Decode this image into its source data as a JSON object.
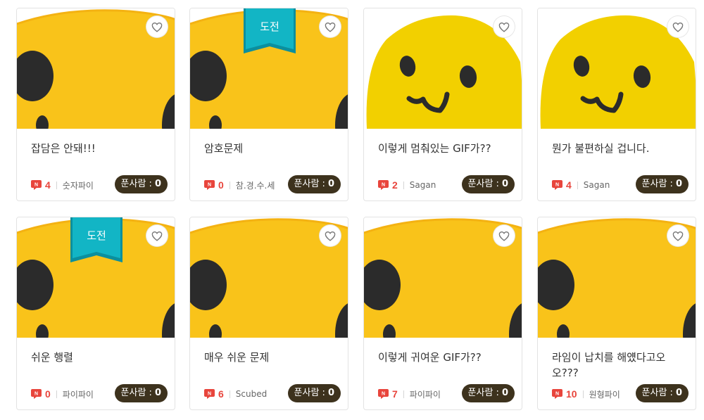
{
  "cards": [
    {
      "title": "잡담은 안돼!!!",
      "solved_label": "푼사람 :",
      "solved_count": "0",
      "comments": "4",
      "author": "숫자파이",
      "challenge": false,
      "image": "face-zoom"
    },
    {
      "title": "암호문제",
      "solved_label": "푼사람 :",
      "solved_count": "0",
      "comments": "0",
      "author": "참.경.수.세",
      "challenge": true,
      "image": "face-zoom"
    },
    {
      "title": "이렇게 멈춰있는 GIF가??",
      "solved_label": "푼사람 :",
      "solved_count": "0",
      "comments": "2",
      "author": "Sagan",
      "challenge": false,
      "image": "face-small"
    },
    {
      "title": "뭔가 불편하실 겁니다.",
      "solved_label": "푼사람 :",
      "solved_count": "0",
      "comments": "4",
      "author": "Sagan",
      "challenge": false,
      "image": "face-small"
    },
    {
      "title": "쉬운 행렬",
      "solved_label": "푼사람 :",
      "solved_count": "0",
      "comments": "0",
      "author": "파이파이",
      "challenge": true,
      "image": "face-zoom"
    },
    {
      "title": "매우 쉬운 문제",
      "solved_label": "푼사람 :",
      "solved_count": "0",
      "comments": "6",
      "author": "Scubed",
      "challenge": false,
      "image": "face-zoom"
    },
    {
      "title": "이렇게 귀여운 GIF가??",
      "solved_label": "푼사람 :",
      "solved_count": "0",
      "comments": "7",
      "author": "파이파이",
      "challenge": false,
      "image": "face-zoom"
    },
    {
      "title": "라임이 납치를 해얬다고오오???",
      "solved_label": "푼사람 :",
      "solved_count": "0",
      "comments": "10",
      "author": "원형파이",
      "challenge": false,
      "image": "face-zoom"
    }
  ],
  "challenge_label": "도전",
  "colors": {
    "face_yellow": "#F9C31A",
    "face_small_yellow": "#F2D000",
    "eye": "#2B2B2B",
    "ribbon": "#12B5C5",
    "comment_red": "#E8453C"
  }
}
